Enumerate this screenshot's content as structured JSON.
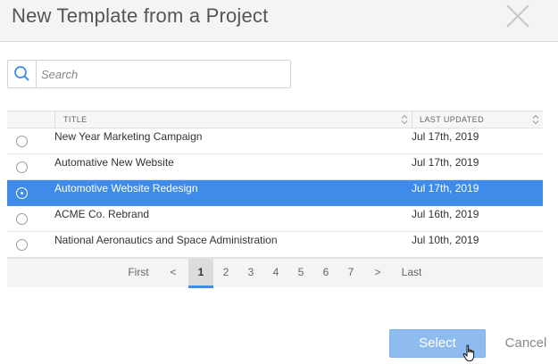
{
  "dialog": {
    "title": "New Template from a Project",
    "close_icon": "close-icon"
  },
  "search": {
    "placeholder": "Search",
    "value": "",
    "icon": "search-icon"
  },
  "table": {
    "columns": {
      "title": "TITLE",
      "last_updated": "LAST UPDATED"
    },
    "rows": [
      {
        "title": "New Year Marketing Campaign",
        "last_updated": "Jul 17th, 2019",
        "selected": false
      },
      {
        "title": "Automative New Website",
        "last_updated": "Jul 17th, 2019",
        "selected": false
      },
      {
        "title": "Automotive Website Redesign",
        "last_updated": "Jul 17th, 2019",
        "selected": true
      },
      {
        "title": "ACME Co. Rebrand",
        "last_updated": "Jul 16th, 2019",
        "selected": false
      },
      {
        "title": "National Aeronautics and Space Administration",
        "last_updated": "Jul 10th, 2019",
        "selected": false
      }
    ]
  },
  "pagination": {
    "first": "First",
    "prev": "<",
    "pages": [
      "1",
      "2",
      "3",
      "4",
      "5",
      "6",
      "7"
    ],
    "active_page": "1",
    "next": ">",
    "last": "Last"
  },
  "footer": {
    "select_label": "Select",
    "cancel_label": "Cancel"
  },
  "colors": {
    "accent": "#3f8be9",
    "select_button": "#8ebcf0",
    "header_bg": "#f4f4f2"
  }
}
